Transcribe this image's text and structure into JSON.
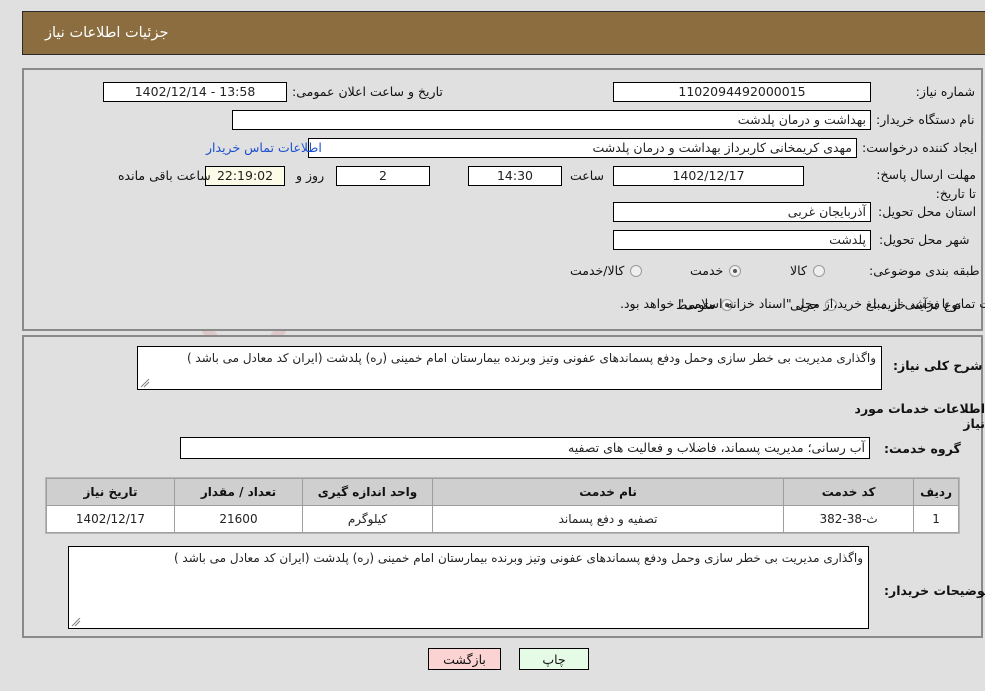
{
  "header": {
    "title": "جزئیات اطلاعات نیاز"
  },
  "form": {
    "need_number_label": "شماره نیاز:",
    "need_number_value": "1102094492000015",
    "announce_datetime_label": "تاریخ و ساعت اعلان عمومی:",
    "announce_datetime_value": "13:58 - 1402/12/14",
    "buyer_org_label": "نام دستگاه خریدار:",
    "buyer_org_value": "بهداشت و درمان پلدشت",
    "creator_label": "ایجاد کننده درخواست:",
    "creator_value": "مهدی کریمخانی کاربرداز بهداشت و درمان پلدشت",
    "buyer_contact_link": "اطلاعات تماس خریدار",
    "deadline_label": "مهلت ارسال پاسخ: تا تاریخ:",
    "deadline_date": "1402/12/17",
    "hour_label": "ساعت",
    "deadline_time": "14:30",
    "days_value": "2",
    "days_and_label": "روز و",
    "countdown_value": "22:19:02",
    "remaining_label": "ساعت باقی مانده",
    "province_label": "استان محل تحویل:",
    "province_value": "آذربایجان غربی",
    "city_label": "شهر محل تحویل:",
    "city_value": "پلدشت",
    "category_label": "طبقه بندی موضوعی:",
    "category_options": [
      "کالا",
      "خدمت",
      "کالا/خدمت"
    ],
    "category_selected_index": 1,
    "purchase_type_label": "نوع فرآیند خرید :",
    "purchase_type_options": [
      "جزیی",
      "متوسط"
    ],
    "purchase_type_selected_index": 1,
    "treasury_checkbox_label": "پرداخت تمام یا بخشی از مبلغ خرید،از محل \"اسناد خزانه اسلامی\" خواهد بود.",
    "treasury_checked": false
  },
  "description": {
    "label": "شرح کلی نیاز:",
    "value": "واگذاری مدیریت بی خطر سازی وحمل ودفع پسماندهای عفونی وتیز وبرنده بیمارستان امام خمینی (ره) پلدشت (ایران کد معادل می باشد )"
  },
  "services_section": {
    "heading": "اطلاعات خدمات مورد نیاز",
    "group_label": "گروه خدمت:",
    "group_value": "آب رسانی؛ مدیریت پسماند، فاضلاب و فعالیت های تصفیه"
  },
  "table": {
    "headers": [
      "ردیف",
      "کد خدمت",
      "نام خدمت",
      "واحد اندازه گیری",
      "تعداد / مقدار",
      "تاریخ نیاز"
    ],
    "rows": [
      {
        "row_no": "1",
        "service_code": "ث-38-382",
        "service_name": "تصفیه و دفع پسماند",
        "unit": "کیلوگرم",
        "quantity": "21600",
        "need_date": "1402/12/17"
      }
    ]
  },
  "buyer_notes": {
    "label": "توضیحات خریدار:",
    "value": "واگذاری مدیریت بی خطر سازی وحمل ودفع پسماندهای عفونی وتیز وبرنده بیمارستان امام خمینی (ره) پلدشت (ایران کد معادل می باشد )"
  },
  "buttons": {
    "print": "چاپ",
    "back": "بازگشت"
  },
  "watermark": {
    "text": "AriaTender.net"
  },
  "colors": {
    "header_bar": "#8c6d3f",
    "page_bg": "#e0e0e0",
    "link": "#1b4fd0",
    "table_header": "#cfcfcf",
    "print_btn": "#e6fbe6",
    "back_btn": "#fbd3d3",
    "countdown_bg": "#fbfbe8"
  }
}
